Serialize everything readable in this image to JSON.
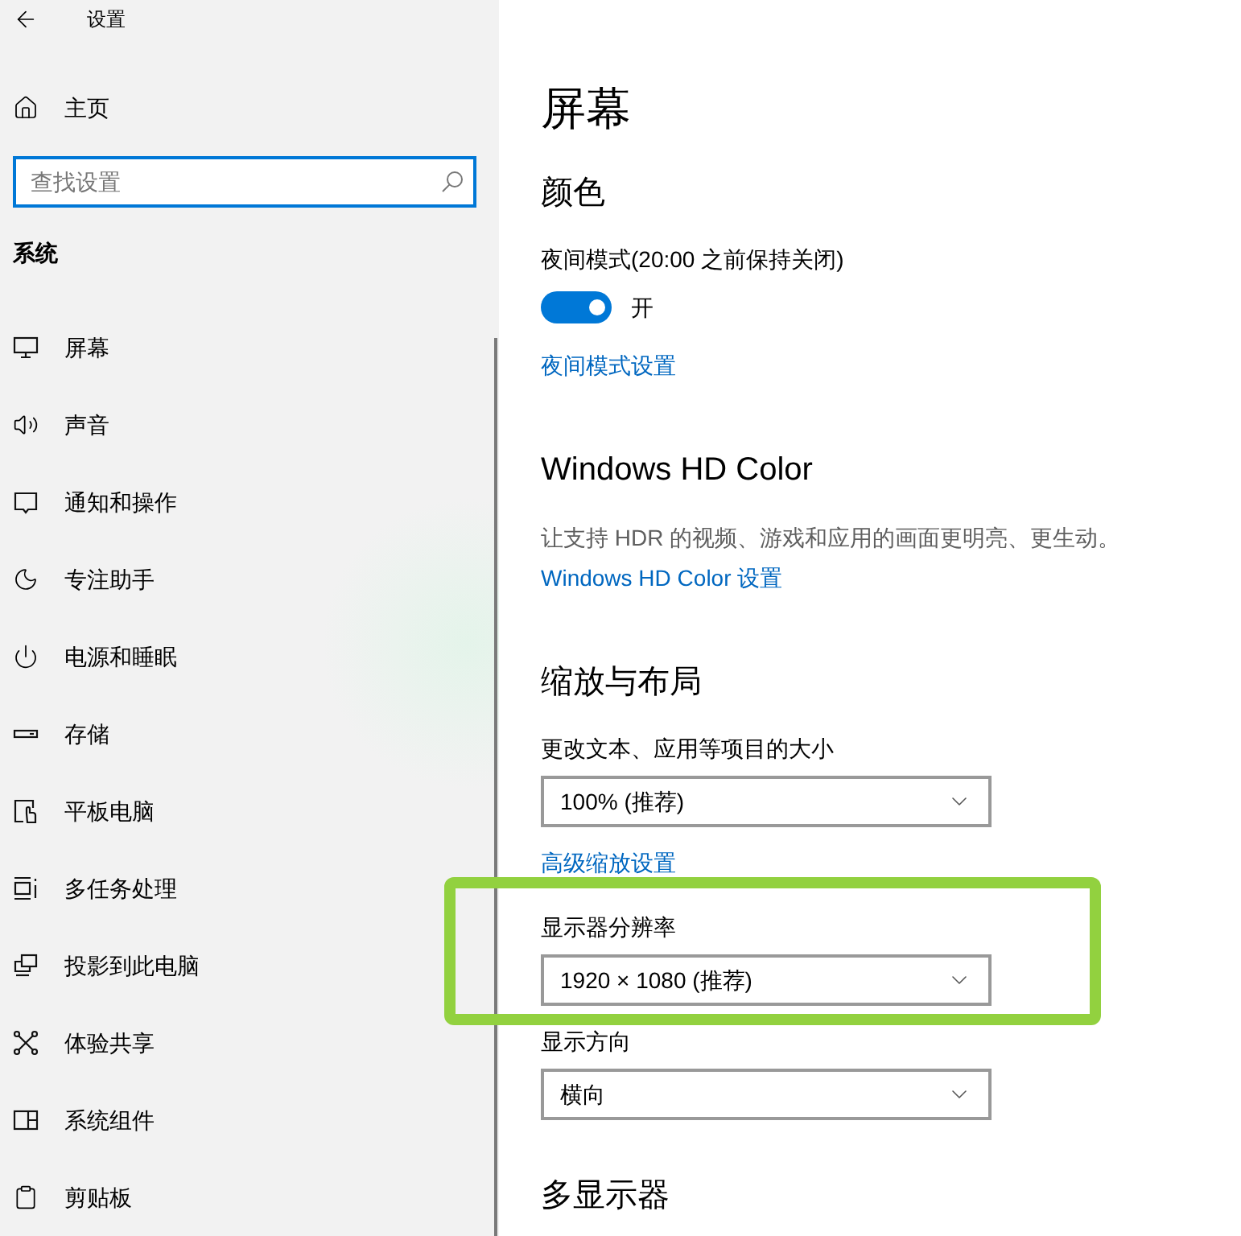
{
  "window": {
    "title": "设置"
  },
  "sidebar": {
    "home": "主页",
    "search": {
      "placeholder": "查找设置"
    },
    "section": "系统",
    "items": [
      {
        "label": "屏幕"
      },
      {
        "label": "声音"
      },
      {
        "label": "通知和操作"
      },
      {
        "label": "专注助手"
      },
      {
        "label": "电源和睡眠"
      },
      {
        "label": "存储"
      },
      {
        "label": "平板电脑"
      },
      {
        "label": "多任务处理"
      },
      {
        "label": "投影到此电脑"
      },
      {
        "label": "体验共享"
      },
      {
        "label": "系统组件"
      },
      {
        "label": "剪贴板"
      }
    ]
  },
  "content": [
    {
      "kind": "page-title",
      "text": "屏幕"
    },
    {
      "kind": "heading",
      "text": "颜色"
    },
    {
      "kind": "label",
      "text": "夜间模式(20:00 之前保持关闭)"
    },
    {
      "kind": "toggle",
      "on": true,
      "text": "开"
    },
    {
      "kind": "link",
      "text": "夜间模式设置"
    },
    {
      "kind": "heading",
      "text": "Windows HD Color"
    },
    {
      "kind": "description",
      "text": "让支持 HDR 的视频、游戏和应用的画面更明亮、更生动。"
    },
    {
      "kind": "link",
      "text": "Windows HD Color 设置"
    },
    {
      "kind": "heading",
      "text": "缩放与布局"
    },
    {
      "kind": "label",
      "text": "更改文本、应用等项目的大小"
    },
    {
      "kind": "dropdown",
      "value": "100% (推荐)"
    },
    {
      "kind": "link",
      "text": "高级缩放设置"
    },
    {
      "kind": "label",
      "text": "显示器分辨率"
    },
    {
      "kind": "dropdown",
      "value": "1920 × 1080 (推荐)"
    },
    {
      "kind": "label",
      "text": "显示方向"
    },
    {
      "kind": "dropdown",
      "value": "横向"
    },
    {
      "kind": "heading",
      "text": "多显示器"
    }
  ]
}
